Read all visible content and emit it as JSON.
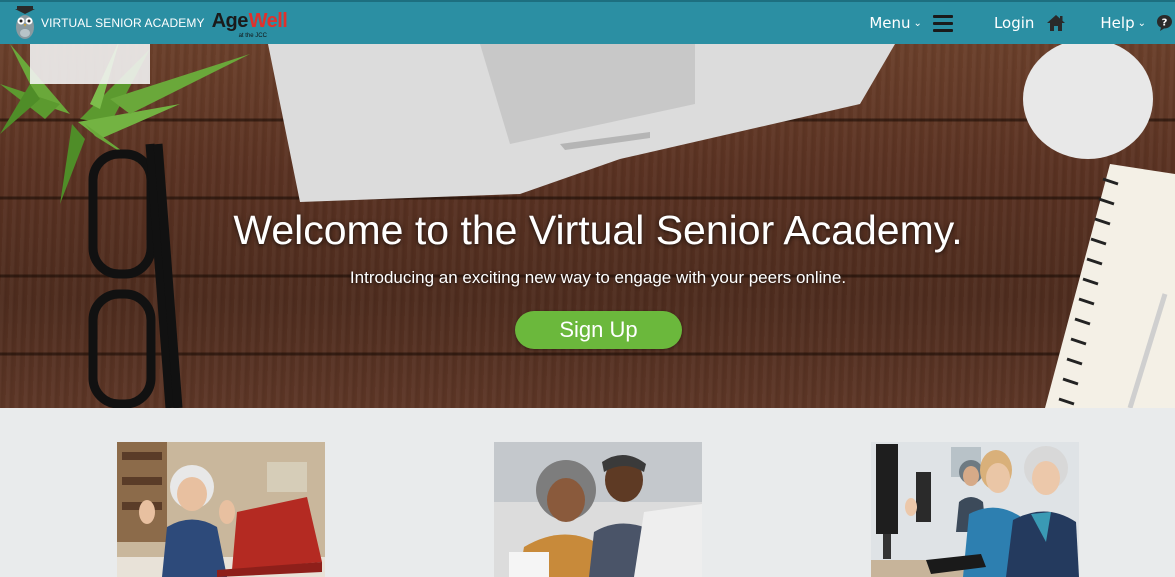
{
  "nav": {
    "brand_text": "VIRTUAL SENIOR ACADEMY",
    "logo": {
      "age": "Age",
      "well": "Well",
      "sub": "at the JCC"
    },
    "menu_label": "Menu",
    "login_label": "Login",
    "help_label": "Help",
    "caret": "⌄"
  },
  "hero": {
    "title": "Welcome to the Virtual Senior Academy.",
    "subtitle": "Introducing an exciting new way to engage with your peers online.",
    "cta_label": "Sign Up"
  },
  "features": [
    {
      "icon": "photo-senior-woman-laptop"
    },
    {
      "icon": "photo-senior-couple-laptop"
    },
    {
      "icon": "photo-seniors-computer-class"
    }
  ],
  "colors": {
    "nav_bg": "#2b8fa3",
    "cta_bg": "#6bb83c",
    "features_bg": "#e9ebec",
    "logo_red": "#e0312c"
  }
}
